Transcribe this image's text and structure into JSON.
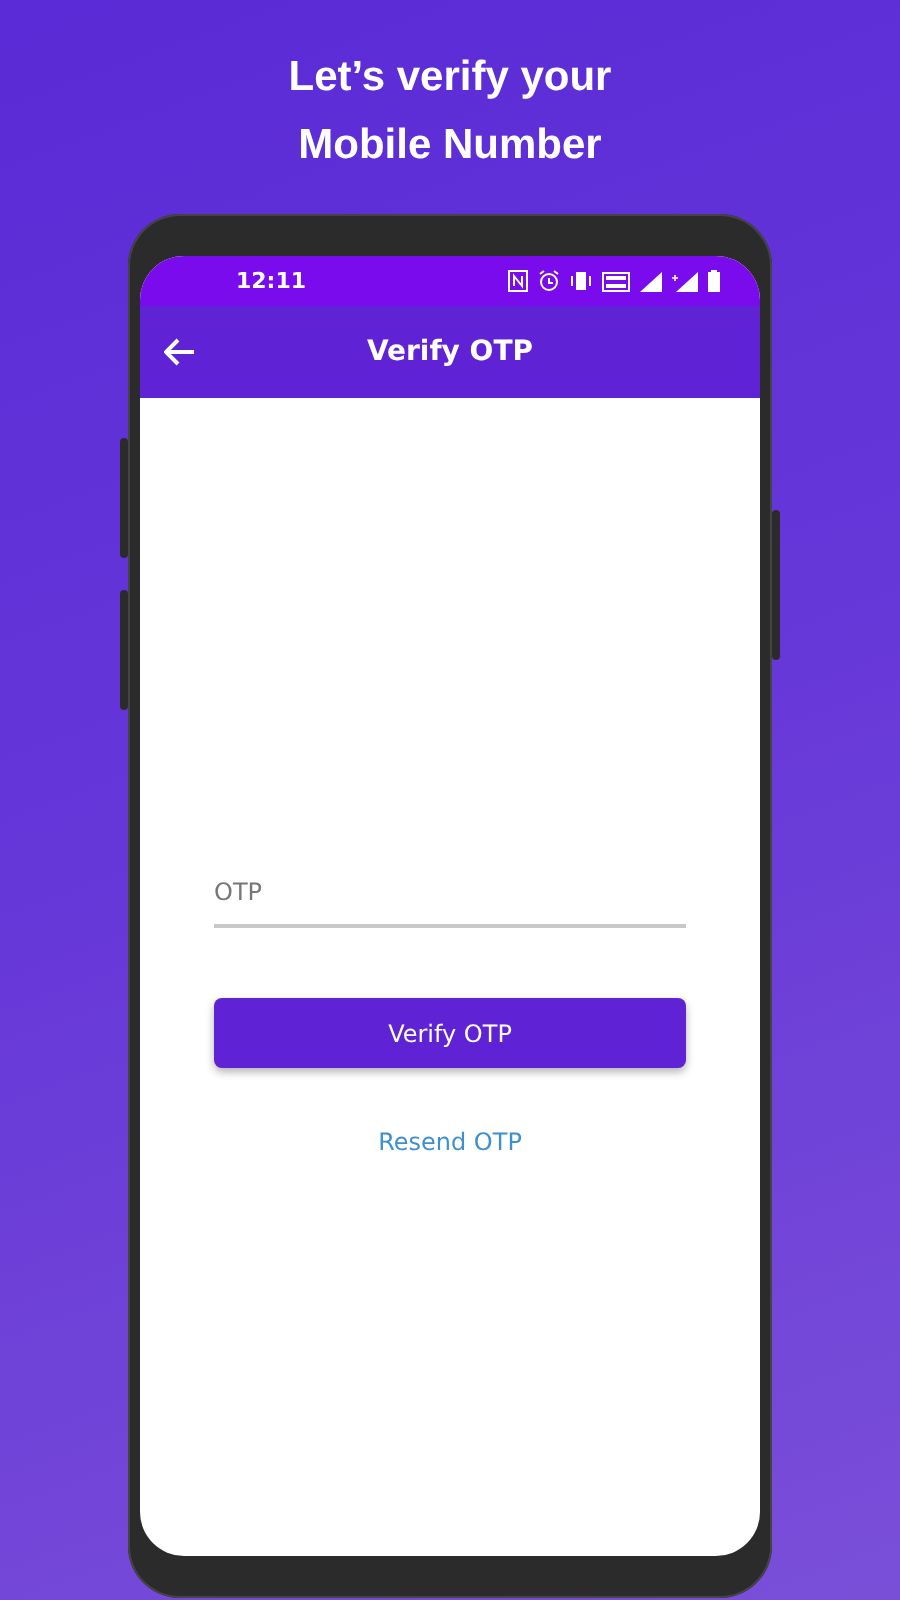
{
  "headline": "Let’s verify your Mobile Number",
  "status_bar": {
    "time": "12:11"
  },
  "app_bar": {
    "title": "Verify OTP"
  },
  "otp_field": {
    "placeholder": "OTP"
  },
  "verify_button": {
    "label": "Verify OTP"
  },
  "resend_link": {
    "label": "Resend OTP"
  }
}
